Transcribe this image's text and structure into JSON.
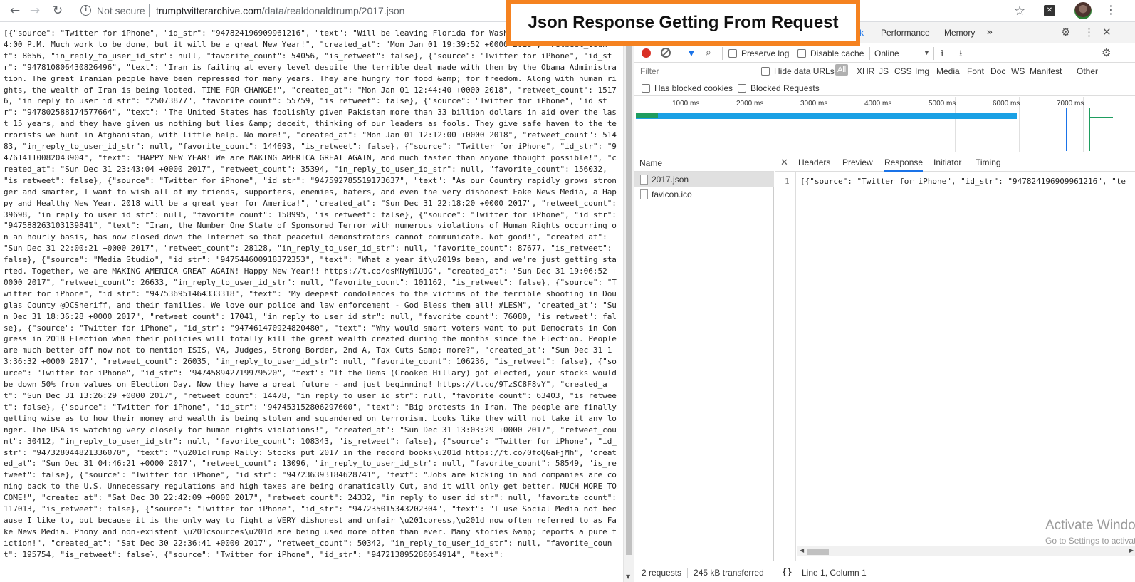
{
  "browser": {
    "nav": {
      "back": "←",
      "forward": "→",
      "reload": "↻"
    },
    "security_label": "Not secure",
    "url_domain": "trumptwitterarchive.com",
    "url_path": "/data/realdonaldtrump/2017.json",
    "icons": [
      "info-icon",
      "star-icon",
      "extension-icon",
      "avatar",
      "menu-icon"
    ]
  },
  "banner": {
    "text": "Json Response Getting From Request",
    "border_color": "#f58220"
  },
  "json_body": "[{\"source\": \"Twitter for iPhone\", \"id_str\": \"947824196909961216\", \"text\": \"Will be leaving Florida for Washington (D.C.) today at 4:00 P.M. Much work to be done, but it will be a great New Year!\", \"created_at\": \"Mon Jan 01 19:39:52 +0000 2018\", \"retweet_count\": 8656, \"in_reply_to_user_id_str\": null, \"favorite_count\": 54056, \"is_retweet\": false}, {\"source\": \"Twitter for iPhone\", \"id_str\": \"947810806430826496\", \"text\": \"Iran is failing at every level despite the terrible deal made with them by the Obama Administration. The great Iranian people have been repressed for many years. They are hungry for food &amp; for freedom. Along with human rights, the wealth of Iran is being looted. TIME FOR CHANGE!\", \"created_at\": \"Mon Jan 01 12:44:40 +0000 2018\", \"retweet_count\": 15176, \"in_reply_to_user_id_str\": \"25073877\", \"favorite_count\": 55759, \"is_retweet\": false}, {\"source\": \"Twitter for iPhone\", \"id_str\": \"947802588174577664\", \"text\": \"The United States has foolishly given Pakistan more than 33 billion dollars in aid over the last 15 years, and they have given us nothing but lies &amp; deceit, thinking of our leaders as fools. They give safe haven to the terrorists we hunt in Afghanistan, with little help. No more!\", \"created_at\": \"Mon Jan 01 12:12:00 +0000 2018\", \"retweet_count\": 51483, \"in_reply_to_user_id_str\": null, \"favorite_count\": 144693, \"is_retweet\": false}, {\"source\": \"Twitter for iPhone\", \"id_str\": \"947614110082043904\", \"text\": \"HAPPY NEW YEAR! We are MAKING AMERICA GREAT AGAIN, and much faster than anyone thought possible!\", \"created_at\": \"Sun Dec 31 23:43:04 +0000 2017\", \"retweet_count\": 35394, \"in_reply_to_user_id_str\": null, \"favorite_count\": 156032, \"is_retweet\": false}, {\"source\": \"Twitter for iPhone\", \"id_str\": \"947592785519173637\", \"text\": \"As our Country rapidly grows stronger and smarter, I want to wish all of my friends, supporters, enemies, haters, and even the very dishonest Fake News Media, a Happy and Healthy New Year. 2018 will be a great year for America!\", \"created_at\": \"Sun Dec 31 22:18:20 +0000 2017\", \"retweet_count\": 39698, \"in_reply_to_user_id_str\": null, \"favorite_count\": 158995, \"is_retweet\": false}, {\"source\": \"Twitter for iPhone\", \"id_str\": \"947588263103139841\", \"text\": \"Iran, the Number One State of Sponsored Terror with numerous violations of Human Rights occurring on an hourly basis, has now closed down the Internet so that peaceful demonstrators cannot communicate. Not good!\", \"created_at\": \"Sun Dec 31 22:00:21 +0000 2017\", \"retweet_count\": 28128, \"in_reply_to_user_id_str\": null, \"favorite_count\": 87677, \"is_retweet\": false}, {\"source\": \"Media Studio\", \"id_str\": \"947544600918372353\", \"text\": \"What a year it\\u2019s been, and we're just getting started. Together, we are MAKING AMERICA GREAT AGAIN! Happy New Year!! https://t.co/qsMNyN1UJG\", \"created_at\": \"Sun Dec 31 19:06:52 +0000 2017\", \"retweet_count\": 26633, \"in_reply_to_user_id_str\": null, \"favorite_count\": 101162, \"is_retweet\": false}, {\"source\": \"Twitter for iPhone\", \"id_str\": \"947536951464333318\", \"text\": \"My deepest condolences to the victims of the terrible shooting in Douglas County @DCSheriff, and their families. We love our police and law enforcement - God Bless them all! #LESM\", \"created_at\": \"Sun Dec 31 18:36:28 +0000 2017\", \"retweet_count\": 17041, \"in_reply_to_user_id_str\": null, \"favorite_count\": 76080, \"is_retweet\": false}, {\"source\": \"Twitter for iPhone\", \"id_str\": \"947461470924820480\", \"text\": \"Why would smart voters want to put Democrats in Congress in 2018 Election when their policies will totally kill the great wealth created during the months since the Election. People are much better off now not to mention ISIS, VA, Judges, Strong Border, 2nd A, Tax Cuts &amp; more?\", \"created_at\": \"Sun Dec 31 13:36:32 +0000 2017\", \"retweet_count\": 26035, \"in_reply_to_user_id_str\": null, \"favorite_count\": 106236, \"is_retweet\": false}, {\"source\": \"Twitter for iPhone\", \"id_str\": \"947458942719979520\", \"text\": \"If the Dems (Crooked Hillary) got elected, your stocks would be down 50% from values on Election Day. Now they have a great future - and just beginning! https://t.co/9TzSC8F8vY\", \"created_at\": \"Sun Dec 31 13:26:29 +0000 2017\", \"retweet_count\": 14478, \"in_reply_to_user_id_str\": null, \"favorite_count\": 63403, \"is_retweet\": false}, {\"source\": \"Twitter for iPhone\", \"id_str\": \"947453152806297600\", \"text\": \"Big protests in Iran. The people are finally getting wise as to how their money and wealth is being stolen and squandered on terrorism. Looks like they will not take it any longer. The USA is watching very closely for human rights violations!\", \"created_at\": \"Sun Dec 31 13:03:29 +0000 2017\", \"retweet_count\": 30412, \"in_reply_to_user_id_str\": null, \"favorite_count\": 108343, \"is_retweet\": false}, {\"source\": \"Twitter for iPhone\", \"id_str\": \"947328044821336070\", \"text\": \"\\u201cTrump Rally: Stocks put 2017 in the record books\\u201d https://t.co/0foQGaFjMh\", \"created_at\": \"Sun Dec 31 04:46:21 +0000 2017\", \"retweet_count\": 13096, \"in_reply_to_user_id_str\": null, \"favorite_count\": 58549, \"is_retweet\": false}, {\"source\": \"Twitter for iPhone\", \"id_str\": \"947236393184628741\", \"text\": \"Jobs are kicking in and companies are coming back to the U.S. Unnecessary regulations and high taxes are being dramatically Cut, and it will only get better. MUCH MORE TO COME!\", \"created_at\": \"Sat Dec 30 22:42:09 +0000 2017\", \"retweet_count\": 24332, \"in_reply_to_user_id_str\": null, \"favorite_count\": 117013, \"is_retweet\": false}, {\"source\": \"Twitter for iPhone\", \"id_str\": \"947235015343202304\", \"text\": \"I use Social Media not because I like to, but because it is the only way to fight a VERY dishonest and unfair \\u201cpress,\\u201d now often referred to as Fake News Media. Phony and non-existent \\u201csources\\u201d are being used more often than ever. Many stories &amp; reports a pure fiction!\", \"created_at\": \"Sat Dec 30 22:36:41 +0000 2017\", \"retweet_count\": 50342, \"in_reply_to_user_id_str\": null, \"favorite_count\": 195754, \"is_retweet\": false}, {\"source\": \"Twitter for iPhone\", \"id_str\": \"947213895286054914\", \"text\":",
  "devtools": {
    "tabs": {
      "performance": "Performance",
      "memory": "Memory",
      "more": "»"
    },
    "toolbar": {
      "preserve_log": "Preserve log",
      "disable_cache": "Disable cache",
      "throttling": "Online"
    },
    "filter": {
      "placeholder": "Filter",
      "hide_data_urls": "Hide data URLs",
      "types": [
        "All",
        "XHR",
        "JS",
        "CSS",
        "Img",
        "Media",
        "Font",
        "Doc",
        "WS",
        "Manifest",
        "Other"
      ]
    },
    "blocked": {
      "has_blocked_cookies": "Has blocked cookies",
      "blocked_requests": "Blocked Requests"
    },
    "timeline_labels": [
      "1000 ms",
      "2000 ms",
      "3000 ms",
      "4000 ms",
      "5000 ms",
      "6000 ms",
      "7000 ms"
    ],
    "requests": {
      "header": "Name",
      "items": [
        "2017.json",
        "favicon.ico"
      ]
    },
    "detail_tabs": [
      "Headers",
      "Preview",
      "Response",
      "Initiator",
      "Timing"
    ],
    "active_detail_tab": "Response",
    "response": {
      "line_number": "1",
      "preview": "[{\"source\": \"Twitter for iPhone\", \"id_str\": \"947824196909961216\", \"te"
    },
    "status": {
      "requests": "2 requests",
      "transferred": "245 kB transferred",
      "cursor": "Line 1, Column 1"
    }
  },
  "watermark": {
    "title": "Activate Windows",
    "subtitle": "Go to Settings to activate Windows."
  }
}
